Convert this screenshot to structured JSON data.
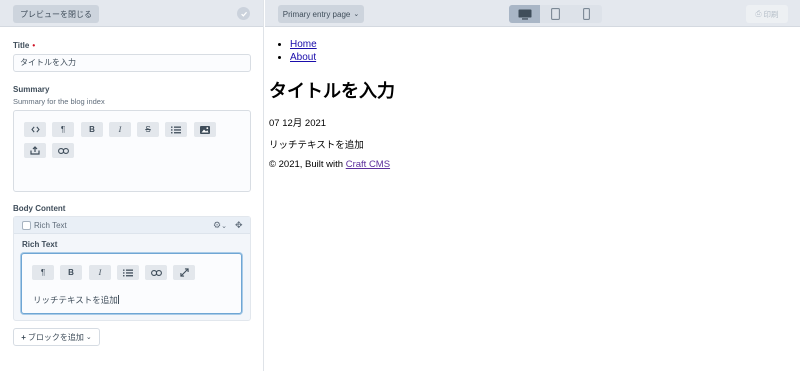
{
  "editor": {
    "close_preview_label": "プレビューを閉じる",
    "title_field": {
      "label": "Title",
      "required_marker": "•",
      "value": "タイトルを入力"
    },
    "summary_field": {
      "label": "Summary",
      "instructions": "Summary for the blog index"
    },
    "body_field": {
      "label": "Body Content"
    },
    "block": {
      "type_label": "Rich Text",
      "field_label": "Rich Text",
      "content": "リッチテキストを追加"
    },
    "add_block_label": "ブロックを追加"
  },
  "preview": {
    "target_label": "Primary entry page",
    "print_label": "印刷",
    "nav": [
      "Home",
      "About"
    ],
    "title": "タイトルを入力",
    "date": "07 12月 2021",
    "body": "リッチテキストを追加",
    "footer_prefix": "© 2021, Built with ",
    "footer_link": "Craft CMS"
  }
}
